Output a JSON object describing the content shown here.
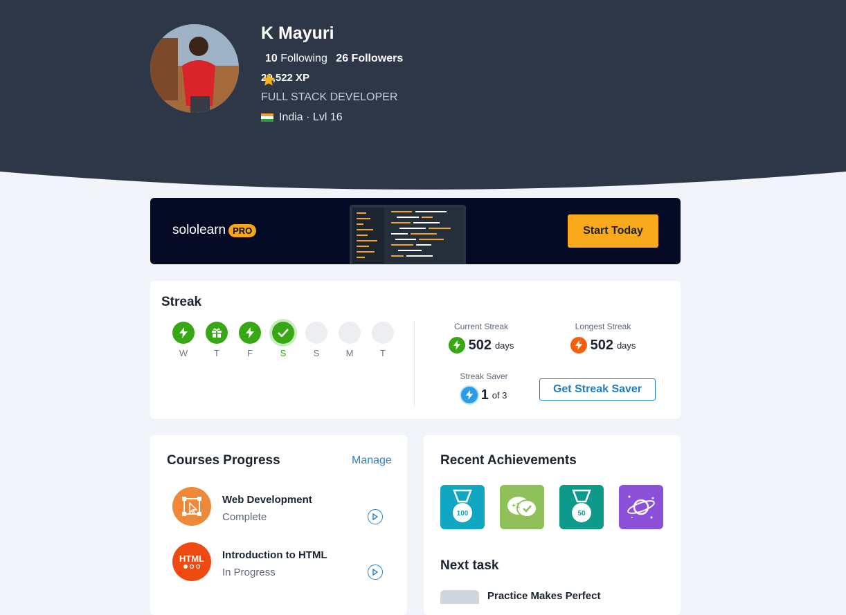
{
  "profile": {
    "name": "K Mayuri",
    "following_count": "10",
    "following_label": "Following",
    "followers_count": "26",
    "followers_label": "Followers",
    "xp": "29,522 XP",
    "role": "FULL STACK DEVELOPER",
    "location": "India · Lvl 16"
  },
  "promo": {
    "logo": "sololearn",
    "badge": "PRO",
    "cta": "Start Today"
  },
  "streak": {
    "title": "Streak",
    "days": [
      {
        "label": "W",
        "state": "done",
        "icon": "lightning-icon"
      },
      {
        "label": "T",
        "state": "done",
        "icon": "gift-icon"
      },
      {
        "label": "F",
        "state": "done",
        "icon": "lightning-icon"
      },
      {
        "label": "S",
        "state": "today",
        "icon": "check-icon"
      },
      {
        "label": "S",
        "state": "empty",
        "icon": ""
      },
      {
        "label": "M",
        "state": "empty",
        "icon": ""
      },
      {
        "label": "T",
        "state": "empty",
        "icon": ""
      }
    ],
    "current_label": "Current Streak",
    "current_value": "502",
    "current_unit": "days",
    "longest_label": "Longest Streak",
    "longest_value": "502",
    "longest_unit": "days",
    "saver_label": "Streak Saver",
    "saver_value": "1",
    "saver_of": "of 3",
    "saver_button": "Get Streak Saver"
  },
  "courses": {
    "title": "Courses Progress",
    "manage": "Manage",
    "items": [
      {
        "title": "Web Development",
        "status": "Complete",
        "icon": "cursor-select-icon"
      },
      {
        "title": "Introduction to HTML",
        "status": "In Progress",
        "icon": "html-icon",
        "icon_text": "HTML"
      }
    ]
  },
  "achievements": {
    "title": "Recent Achievements",
    "badges": [
      {
        "name": "medal-100-icon",
        "text": "100",
        "color": "#11a7c2"
      },
      {
        "name": "plus-one-chat-icon",
        "text": "+1",
        "color": "#8fc15a"
      },
      {
        "name": "medal-50-icon",
        "text": "50",
        "color": "#0e9a8b"
      },
      {
        "name": "planet-icon",
        "text": "",
        "color": "#8b4fd8"
      }
    ],
    "next_title": "Next task",
    "next_task": "Practice Makes Perfect"
  },
  "colors": {
    "header_bg": "#2d3748",
    "accent_orange": "#f8a91c",
    "streak_green": "#37a814",
    "link_blue": "#2a82c6"
  }
}
